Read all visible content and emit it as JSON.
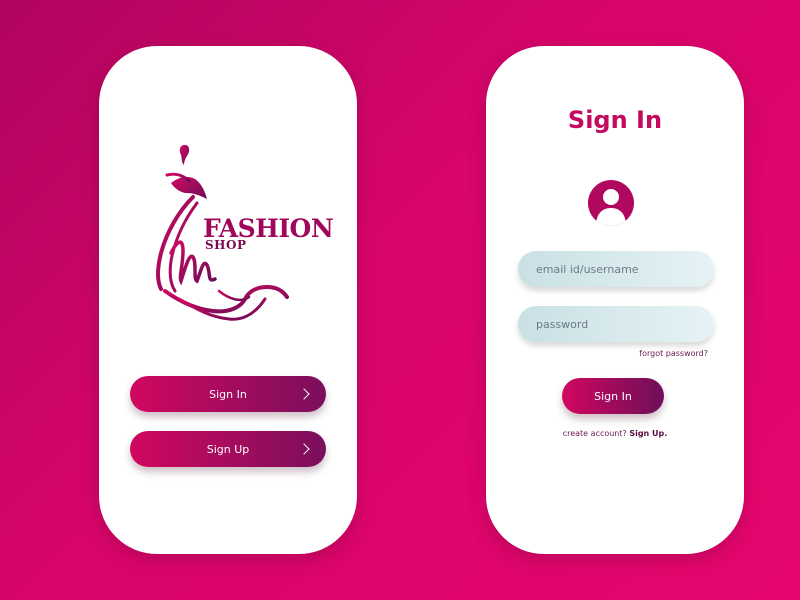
{
  "colors": {
    "background_start": "#b0055f",
    "background_end": "#e6066d",
    "accent": "#c4095f",
    "button_gradient_start": "#d1075f",
    "button_gradient_end": "#7a0f5c",
    "field_background": "#d9eaed"
  },
  "welcome": {
    "logo": {
      "icon": "dress-sketch-icon",
      "title": "FASHION",
      "subtitle": "SHOP"
    },
    "buttons": [
      {
        "label": "Sign In",
        "icon": "chevron-right-icon"
      },
      {
        "label": "Sign Up",
        "icon": "chevron-right-icon"
      }
    ]
  },
  "signin": {
    "title": "Sign In",
    "avatar_icon": "user-icon",
    "email_placeholder": "email id/username",
    "password_placeholder": "password",
    "forgot_password": "forgot password?",
    "submit_label": "Sign In",
    "create_account_text": "create account?",
    "create_account_link": "Sign Up."
  }
}
